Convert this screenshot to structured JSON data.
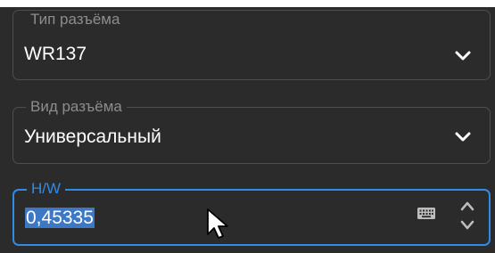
{
  "connector_type": {
    "label": "Тип разъёма",
    "value": "WR137"
  },
  "connector_kind": {
    "label": "Вид разъёма",
    "value": "Универсальный"
  },
  "hw_ratio": {
    "label": "H/W",
    "value": "0,45335"
  },
  "colors": {
    "panel_background": "#2b2b2b",
    "border": "#4e4e4e",
    "accent": "#2f8be6",
    "selection": "#3d78c4",
    "label": "#8d8d8d",
    "text": "#ffffff"
  },
  "icons": {
    "dropdown": "chevron-down-icon",
    "keyboard": "keyboard-icon",
    "spin": "spin-up-down-icon",
    "pointer": "mouse-cursor-icon"
  }
}
